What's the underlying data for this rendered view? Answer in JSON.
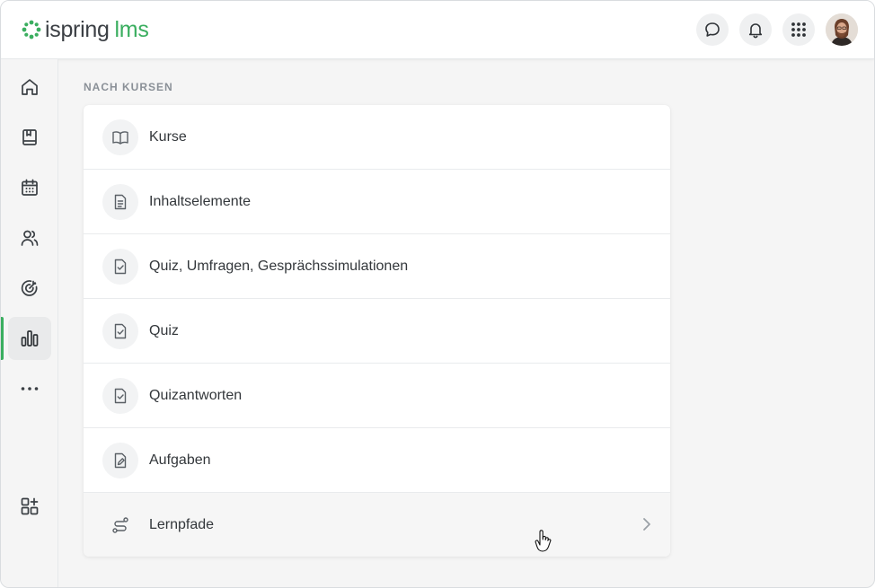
{
  "header": {
    "logo": {
      "brand": "ispring",
      "product": "lms",
      "brand_color": "#3b3f44",
      "product_color": "#3aae5f"
    },
    "actions": [
      {
        "name": "chat",
        "icon": "chat-bubble-icon"
      },
      {
        "name": "notifications",
        "icon": "bell-icon"
      },
      {
        "name": "apps",
        "icon": "grid-dots-icon"
      },
      {
        "name": "profile",
        "icon": "avatar"
      }
    ]
  },
  "sidebar": {
    "items": [
      {
        "name": "home",
        "icon": "home-icon",
        "active": false
      },
      {
        "name": "library",
        "icon": "book-icon",
        "active": false
      },
      {
        "name": "calendar",
        "icon": "calendar-icon",
        "active": false
      },
      {
        "name": "users",
        "icon": "users-icon",
        "active": false
      },
      {
        "name": "goals",
        "icon": "target-icon",
        "active": false
      },
      {
        "name": "reports",
        "icon": "bar-chart-icon",
        "active": true
      },
      {
        "name": "more",
        "icon": "more-dots-icon",
        "active": false
      },
      {
        "name": "add-widgets",
        "icon": "add-grid-icon",
        "active": false
      }
    ],
    "accent_color": "#3aae5f"
  },
  "main": {
    "section_title": "NACH KURSEN",
    "items": [
      {
        "label": "Kurse",
        "icon": "open-book-icon"
      },
      {
        "label": "Inhaltselemente",
        "icon": "document-icon"
      },
      {
        "label": "Quiz, Umfragen, Gesprächssimulationen",
        "icon": "checklist-icon"
      },
      {
        "label": "Quiz",
        "icon": "checklist-icon"
      },
      {
        "label": "Quizantworten",
        "icon": "checklist-icon"
      },
      {
        "label": "Aufgaben",
        "icon": "edit-document-icon"
      },
      {
        "label": "Lernpfade",
        "icon": "route-icon",
        "hovered": true
      }
    ]
  }
}
